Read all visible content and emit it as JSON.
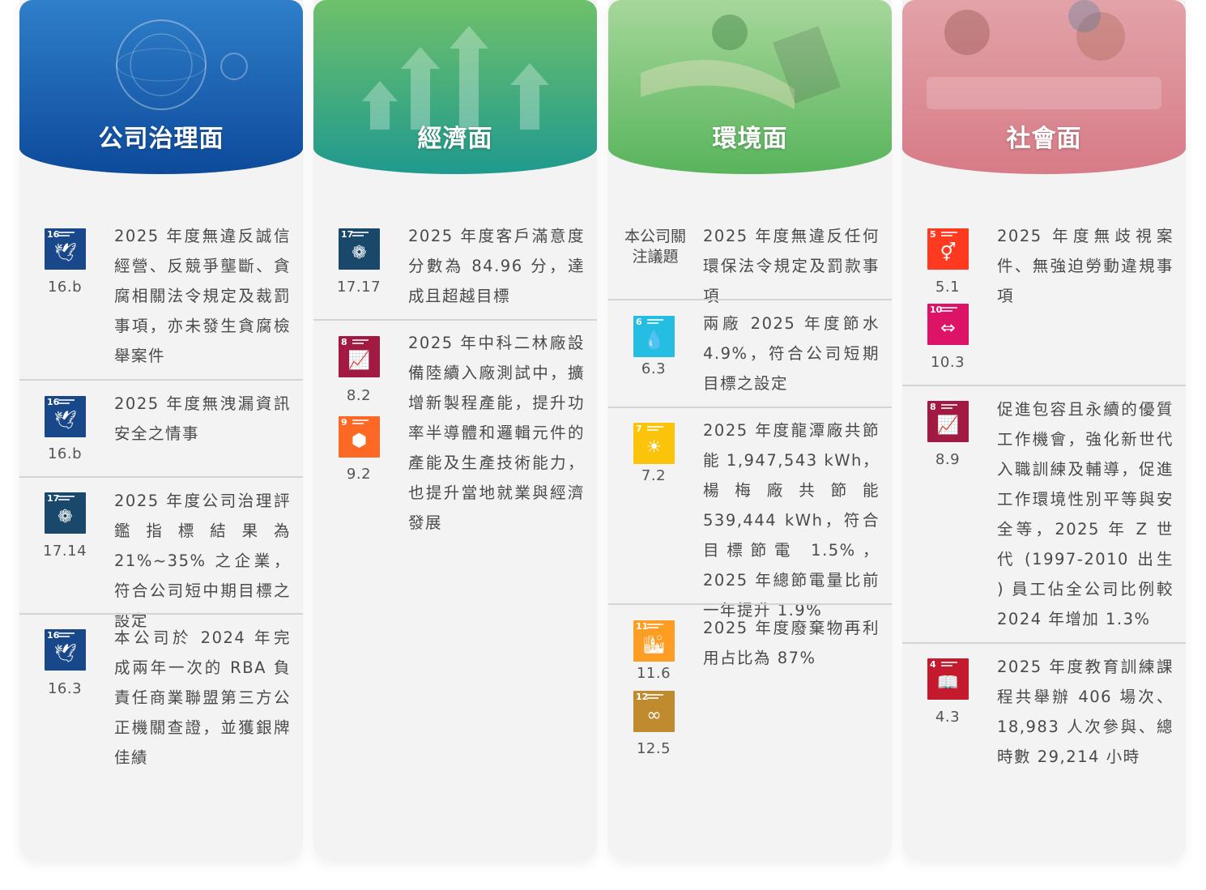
{
  "columns": [
    {
      "title": "公司治理面",
      "colors": {
        "top": "#2f7fc9",
        "bottom": "#0d4a9b"
      },
      "items": [
        {
          "icons": [
            {
              "name": "sdg16-peace-icon",
              "num": "16",
              "color": "#19488a",
              "glyph": "🕊",
              "code": "16.b"
            }
          ],
          "text": "2025 年度無違反誠信經營、反競爭壟斷、貪腐相關法令規定及裁罰事項，亦未發生貪腐檢舉案件"
        },
        {
          "icons": [
            {
              "name": "sdg16-peace-icon",
              "num": "16",
              "color": "#19488a",
              "glyph": "🕊",
              "code": "16.b"
            }
          ],
          "text": "2025 年度無洩漏資訊安全之情事"
        },
        {
          "icons": [
            {
              "name": "sdg17-partnership-icon",
              "num": "17",
              "color": "#19486a",
              "glyph": "❁",
              "code": "17.14"
            }
          ],
          "text": "2025 年度公司治理評鑑指標結果為 21%~35% 之企業，符合公司短中期目標之設定"
        },
        {
          "icons": [
            {
              "name": "sdg16-peace-icon",
              "num": "16",
              "color": "#19488a",
              "glyph": "🕊",
              "code": "16.3"
            }
          ],
          "text": "本公司於 2024 年完成兩年一次的 RBA 負責任商業聯盟第三方公正機關查證，並獲銀牌佳績"
        }
      ]
    },
    {
      "title": "經濟面",
      "colors": {
        "top": "#6fc06a",
        "bottom": "#1f9a8e"
      },
      "items": [
        {
          "icons": [
            {
              "name": "sdg17-partnership-icon",
              "num": "17",
              "color": "#19486a",
              "glyph": "❁",
              "code": "17.17"
            }
          ],
          "text": "2025 年度客戶滿意度分數為 84.96 分，達成且超越目標"
        },
        {
          "icons": [
            {
              "name": "sdg8-growth-icon",
              "num": "8",
              "color": "#a21942",
              "glyph": "📈",
              "code": "8.2"
            },
            {
              "name": "sdg9-industry-icon",
              "num": "9",
              "color": "#fd6925",
              "glyph": "⬢",
              "code": "9.2"
            }
          ],
          "text": "2025 年中科二林廠設備陸續入廠測試中，擴增新製程產能，提升功率半導體和邏輯元件的產能及生產技術能力，也提升當地就業與經濟發展"
        }
      ]
    },
    {
      "title": "環境面",
      "colors": {
        "top": "#a6d79a",
        "bottom": "#58b45c"
      },
      "topic_label": "本公司關注議題",
      "items": [
        {
          "icons": [],
          "text": "2025 年度無違反任何環保法令規定及罰款事項"
        },
        {
          "icons": [
            {
              "name": "sdg6-water-icon",
              "num": "6",
              "color": "#26bde2",
              "glyph": "💧",
              "code": "6.3"
            }
          ],
          "text": "兩廠 2025 年度節水 4.9%，符合公司短期目標之設定"
        },
        {
          "icons": [
            {
              "name": "sdg7-energy-icon",
              "num": "7",
              "color": "#fcc30b",
              "glyph": "☀",
              "code": "7.2"
            }
          ],
          "text": "2025 年度龍潭廠共節能 1,947,543 kWh，楊梅廠共節能 539,444 kWh，符合目標節電 1.5%，2025 年總節電量比前一年提升 1.9%"
        },
        {
          "icons": [
            {
              "name": "sdg11-cities-icon",
              "num": "11",
              "color": "#fd9d24",
              "glyph": "🏙",
              "code": "11.6"
            },
            {
              "name": "sdg12-consumption-icon",
              "num": "12",
              "color": "#bf8b2e",
              "glyph": "∞",
              "code": "12.5"
            }
          ],
          "text": "2025 年度廢棄物再利用占比為 87%"
        }
      ]
    },
    {
      "title": "社會面",
      "colors": {
        "top": "#e2a3a8",
        "bottom": "#d77b87"
      },
      "items": [
        {
          "icons": [
            {
              "name": "sdg5-gender-icon",
              "num": "5",
              "color": "#ff3a21",
              "glyph": "⚥",
              "code": "5.1"
            },
            {
              "name": "sdg10-inequality-icon",
              "num": "10",
              "color": "#dd1367",
              "glyph": "⇔",
              "code": "10.3"
            }
          ],
          "text": "2025 年度無歧視案件、無強迫勞動違規事項"
        },
        {
          "icons": [
            {
              "name": "sdg8-growth-icon",
              "num": "8",
              "color": "#a21942",
              "glyph": "📈",
              "code": "8.9"
            }
          ],
          "text": "促進包容且永續的優質工作機會，強化新世代入職訓練及輔導，促進工作環境性別平等與安全等，2025 年 Z 世代 (1997-2010 出生 ) 員工佔全公司比例較 2024 年增加 1.3%"
        },
        {
          "icons": [
            {
              "name": "sdg4-education-icon",
              "num": "4",
              "color": "#c5192d",
              "glyph": "📖",
              "code": "4.3"
            }
          ],
          "text": "2025 年度教育訓練課程共舉辦 406 場次、18,983 人次參與、總時數 29,214 小時"
        }
      ]
    }
  ]
}
